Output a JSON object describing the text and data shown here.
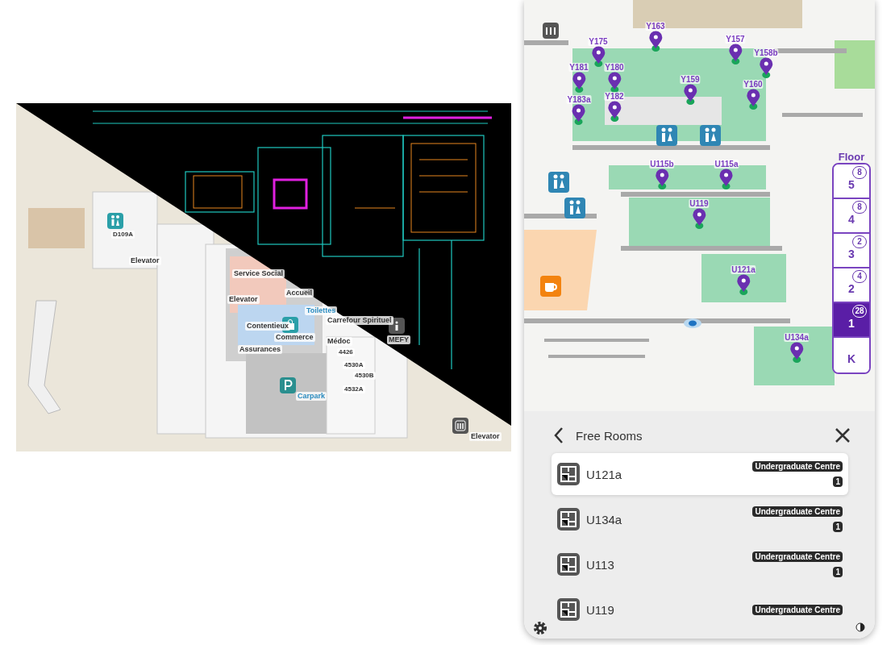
{
  "site_map": {
    "labels": [
      {
        "text": "D109A",
        "kind": "room"
      },
      {
        "text": "Elevator",
        "kind": "poi"
      },
      {
        "text": "Service Social",
        "kind": "poi"
      },
      {
        "text": "Accueil",
        "kind": "poi"
      },
      {
        "text": "Elevator",
        "kind": "poi"
      },
      {
        "text": "Toilettes",
        "kind": "link"
      },
      {
        "text": "Contentieux",
        "kind": "poi"
      },
      {
        "text": "Carrefour Spirituel",
        "kind": "poi"
      },
      {
        "text": "Commerce",
        "kind": "poi"
      },
      {
        "text": "Médoc",
        "kind": "poi"
      },
      {
        "text": "Assurances",
        "kind": "poi"
      },
      {
        "text": "MEFY",
        "kind": "poi"
      },
      {
        "text": "4426",
        "kind": "room"
      },
      {
        "text": "4530A",
        "kind": "room"
      },
      {
        "text": "4530B",
        "kind": "room"
      },
      {
        "text": "4532A",
        "kind": "room"
      },
      {
        "text": "Carpark",
        "kind": "link"
      },
      {
        "text": "Elevator",
        "kind": "poi"
      }
    ]
  },
  "phone": {
    "map_pins": [
      {
        "label": "Y163"
      },
      {
        "label": "Y175"
      },
      {
        "label": "Y180"
      },
      {
        "label": "Y181"
      },
      {
        "label": "Y182"
      },
      {
        "label": "Y183a"
      },
      {
        "label": "Y157"
      },
      {
        "label": "Y158b"
      },
      {
        "label": "Y159"
      },
      {
        "label": "Y160"
      },
      {
        "label": "U115b"
      },
      {
        "label": "U115a"
      },
      {
        "label": "U119"
      },
      {
        "label": "U121a"
      },
      {
        "label": "U134a"
      }
    ],
    "floor_selector": {
      "title": "Floor",
      "floors": [
        {
          "label": "5",
          "count": "8",
          "selected": false
        },
        {
          "label": "4",
          "count": "8",
          "selected": false
        },
        {
          "label": "3",
          "count": "2",
          "selected": false
        },
        {
          "label": "2",
          "count": "4",
          "selected": false
        },
        {
          "label": "1",
          "count": "28",
          "selected": true
        },
        {
          "label": "K",
          "selected": false
        }
      ]
    },
    "panel": {
      "title": "Free Rooms",
      "rooms": [
        {
          "name": "U121a",
          "building": "Undergraduate Centre",
          "floor": "1",
          "selected": true
        },
        {
          "name": "U134a",
          "building": "Undergraduate Centre",
          "floor": "1",
          "selected": false
        },
        {
          "name": "U113",
          "building": "Undergraduate Centre",
          "floor": "1",
          "selected": false
        },
        {
          "name": "U119",
          "building": "Undergraduate Centre",
          "selected": false
        }
      ]
    }
  }
}
